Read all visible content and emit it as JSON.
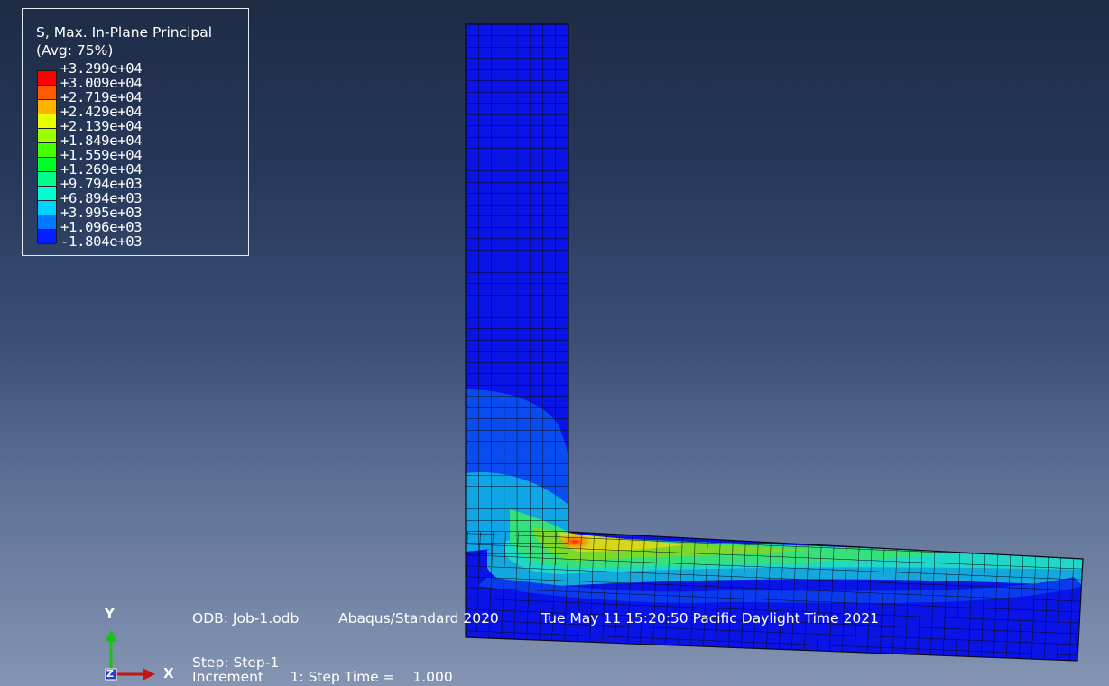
{
  "legend": {
    "title_line1": "S, Max. In-Plane Principal",
    "title_line2": "(Avg: 75%)",
    "values": [
      "+3.299e+04",
      "+3.009e+04",
      "+2.719e+04",
      "+2.429e+04",
      "+2.139e+04",
      "+1.849e+04",
      "+1.559e+04",
      "+1.269e+04",
      "+9.794e+03",
      "+6.894e+03",
      "+3.995e+03",
      "+1.096e+03",
      "-1.804e+03"
    ],
    "colors": [
      "#ff0000",
      "#ff5a00",
      "#ffb300",
      "#e8ff00",
      "#9cff00",
      "#46ff00",
      "#00ff2a",
      "#00ff8a",
      "#00ffcf",
      "#00d2ff",
      "#0078ff",
      "#0020ff"
    ]
  },
  "info": {
    "odb": "ODB: Job-1.odb",
    "solver": "Abaqus/Standard 2020",
    "date": "Tue May 11 15:20:50 Pacific Daylight Time 2021",
    "step": "Step: Step-1",
    "increment": "Increment      1: Step Time =    1.000"
  },
  "triad": {
    "y_label": "Y",
    "x_label": "X",
    "z_label": "Z"
  }
}
